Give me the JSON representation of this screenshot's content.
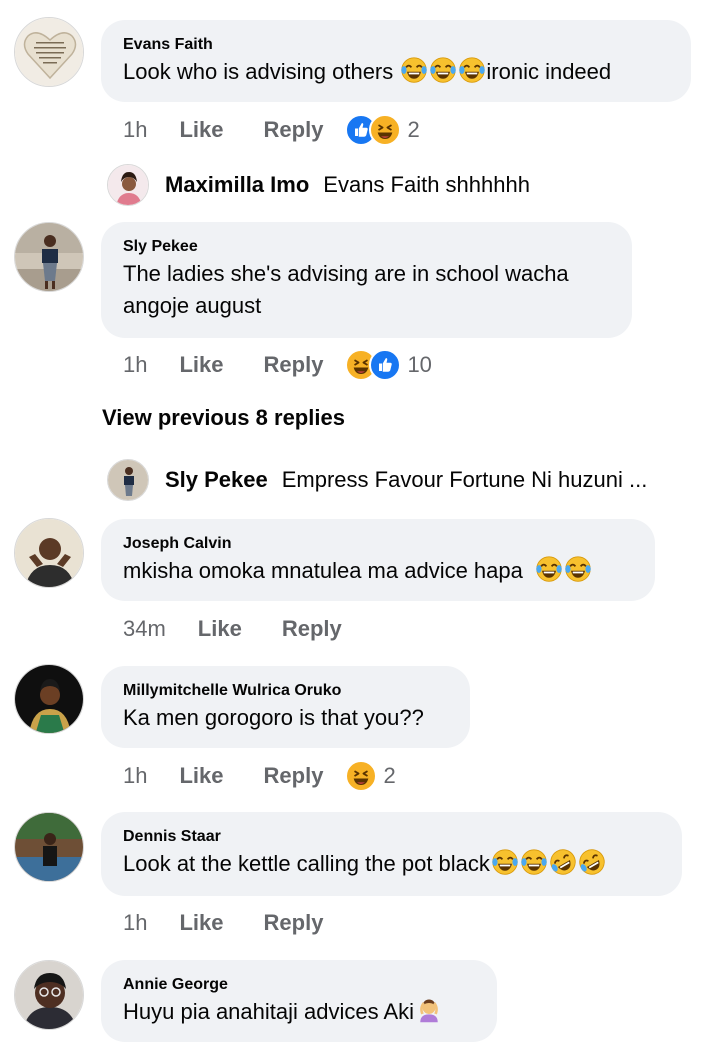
{
  "comments": [
    {
      "author": "Evans Faith",
      "text": "Look who is advising others",
      "text_after_emojis": "ironic indeed",
      "time": "1h",
      "like": "Like",
      "reply": "Reply",
      "reactions": [
        "like",
        "haha"
      ],
      "reaction_count": "2"
    },
    {
      "author": "Sly Pekee",
      "text": "The ladies she's advising are in school wacha angoje august",
      "time": "1h",
      "like": "Like",
      "reply": "Reply",
      "reactions": [
        "haha",
        "like"
      ],
      "reaction_count": "10"
    },
    {
      "author": "Joseph Calvin",
      "text": "mkisha omoka mnatulea ma advice hapa",
      "time": "34m",
      "like": "Like",
      "reply": "Reply"
    },
    {
      "author": "Millymitchelle Wulrica Oruko",
      "text": "Ka men gorogoro is that you??",
      "time": "1h",
      "like": "Like",
      "reply": "Reply",
      "reactions": [
        "haha"
      ],
      "reaction_count": "2"
    },
    {
      "author": "Dennis Staar",
      "text": "Look at the kettle calling the pot black",
      "time": "1h",
      "like": "Like",
      "reply": "Reply"
    },
    {
      "author": "Annie George",
      "text": "Huyu pia anahitaji advices Aki"
    }
  ],
  "replies": [
    {
      "author": "Maximilla Imo",
      "text": "Evans Faith shhhhhh"
    },
    {
      "author": "Sly Pekee",
      "text": "Empress Favour Fortune Ni huzuni ..."
    }
  ],
  "view_previous": "View previous 8 replies",
  "icons": {
    "tears_of_joy": "face-with-tears-of-joy-icon",
    "rofl": "rolling-on-floor-laughing-icon",
    "facepalm": "person-gesturing-icon",
    "like": "thumbs-up-icon",
    "haha": "laughing-face-icon"
  },
  "colors": {
    "bubble": "#f0f2f5",
    "secondary_text": "#65676b",
    "like_blue": "#1877f2",
    "haha_yellow": "#f7b125"
  }
}
